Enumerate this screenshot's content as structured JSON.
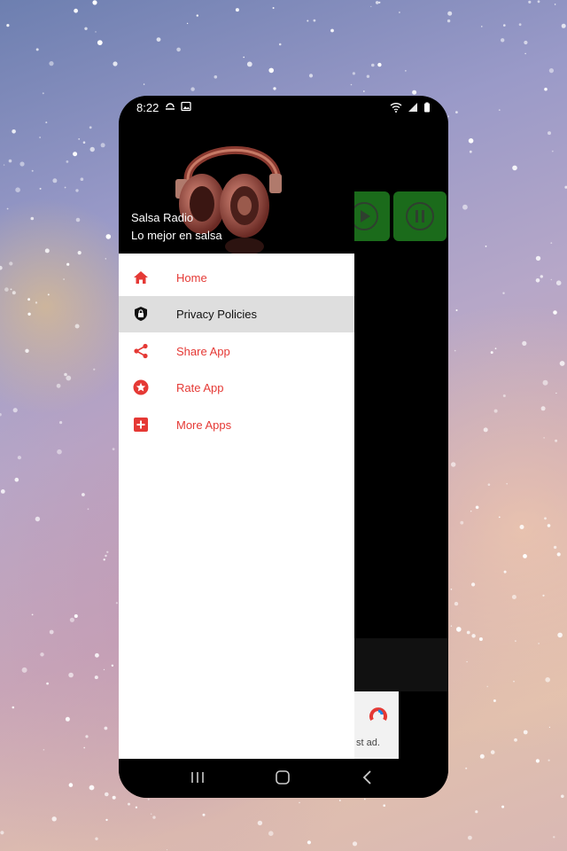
{
  "status_bar": {
    "time": "8:22"
  },
  "drawer": {
    "title": "Salsa Radio",
    "subtitle": "Lo mejor en salsa",
    "items": [
      {
        "label": "Home",
        "icon": "home-icon",
        "active": false
      },
      {
        "label": "Privacy Policies",
        "icon": "shield-lock-icon",
        "active": true
      },
      {
        "label": "Share App",
        "icon": "share-icon",
        "active": false
      },
      {
        "label": "Rate App",
        "icon": "star-icon",
        "active": false
      },
      {
        "label": "More Apps",
        "icon": "plus-box-icon",
        "active": false
      }
    ]
  },
  "ad": {
    "text": "st ad."
  },
  "colors": {
    "accent": "#e53935",
    "active_row": "#dedede",
    "control_green": "#1b6b1b"
  }
}
